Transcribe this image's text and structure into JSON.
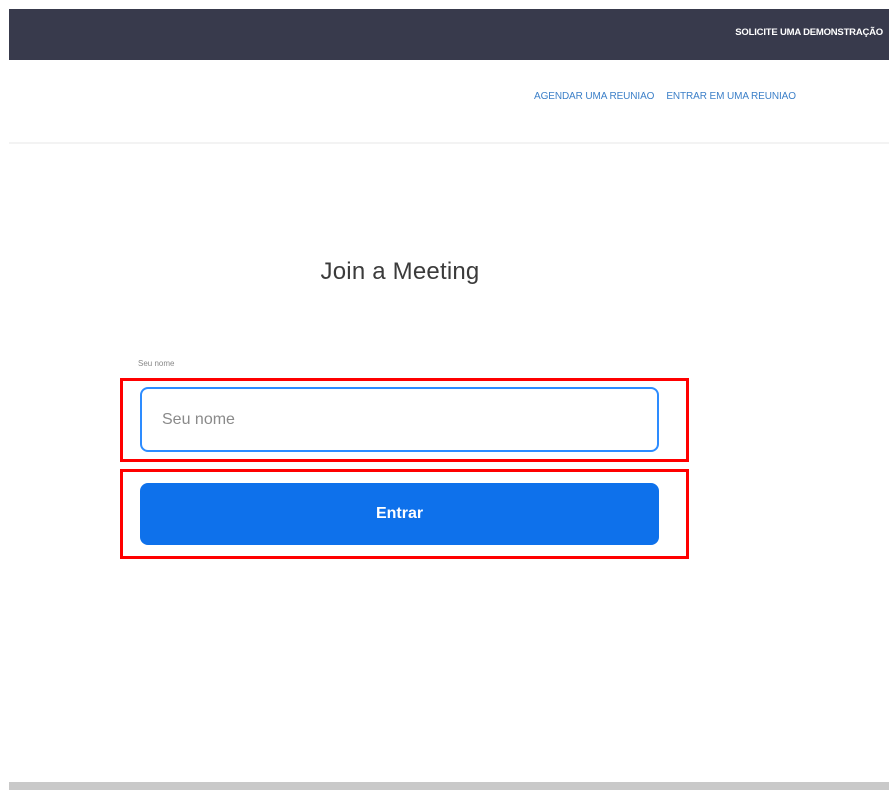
{
  "header": {
    "demo_link": "SOLICITE UMA DEMONSTRAÇÃO"
  },
  "nav": {
    "links": [
      {
        "label": "AGENDAR UMA REUNIÃO"
      },
      {
        "label": "ENTRAR EM UMA REUNIÃO"
      }
    ]
  },
  "main": {
    "title": "Join a Meeting",
    "name_field": {
      "label": "Seu nome",
      "placeholder": "Seu nome",
      "value": ""
    },
    "submit_label": "Entrar"
  },
  "colors": {
    "top_bar": "#383a4c",
    "accent": "#0e71eb",
    "input_border": "#2d8cff",
    "nav_link": "#3b7fc8",
    "highlight": "#ff0000"
  }
}
